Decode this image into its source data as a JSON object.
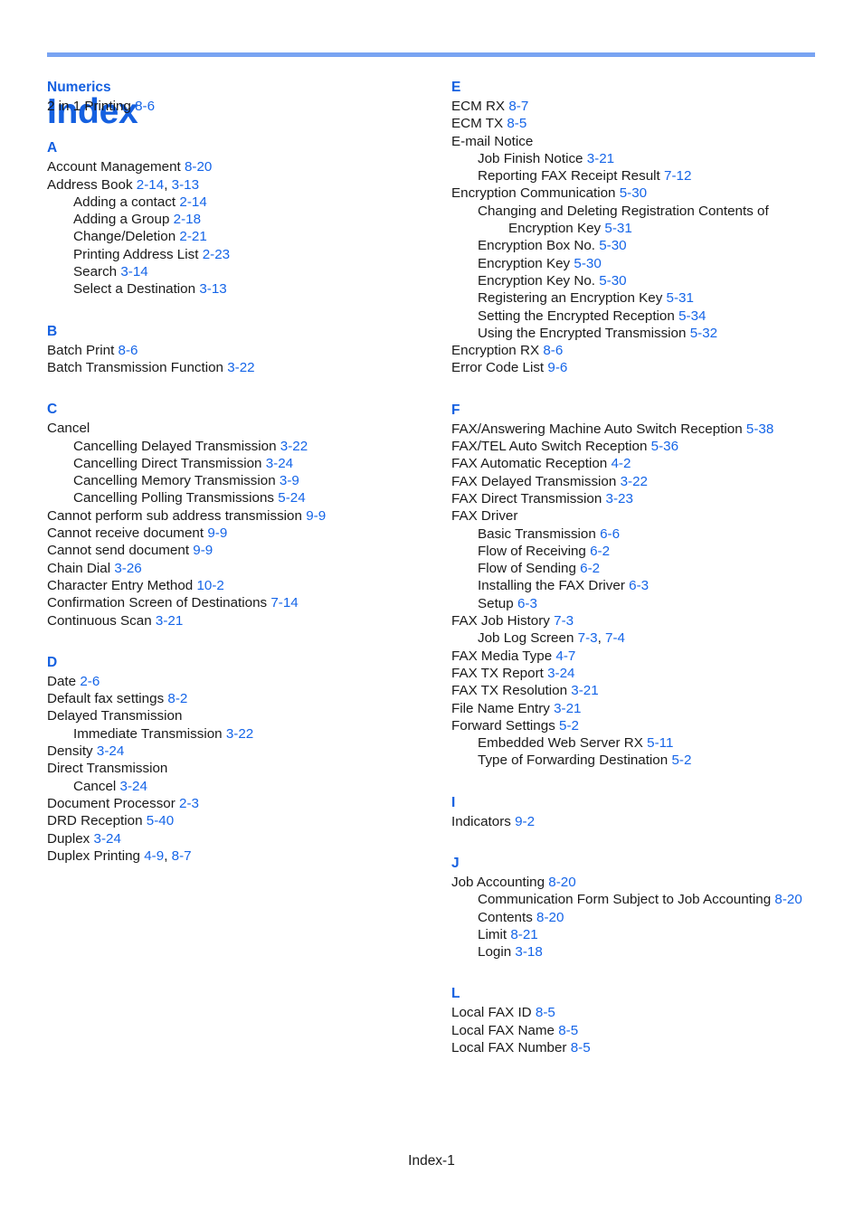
{
  "document": {
    "title": "Index",
    "footer": "Index-1"
  },
  "theme": {
    "rule_color": "#79a4f2",
    "title_color": "#1560e0",
    "section_letter_color": "#1560e0",
    "reference_color": "#1565e8",
    "text_color": "#1a1a1a",
    "background": "#ffffff"
  },
  "columns": [
    {
      "name": "left",
      "sections": [
        {
          "letter": "Numerics",
          "entries": [
            {
              "level": 0,
              "text": "2 in 1 Printing",
              "refs": [
                "8-6"
              ]
            }
          ]
        },
        {
          "letter": "A",
          "entries": [
            {
              "level": 0,
              "text": "Account Management",
              "refs": [
                "8-20"
              ]
            },
            {
              "level": 0,
              "text": "Address Book",
              "refs": [
                "2-14",
                "3-13"
              ]
            },
            {
              "level": 1,
              "text": "Adding a contact",
              "refs": [
                "2-14"
              ]
            },
            {
              "level": 1,
              "text": "Adding a Group",
              "refs": [
                "2-18"
              ]
            },
            {
              "level": 1,
              "text": "Change/Deletion",
              "refs": [
                "2-21"
              ]
            },
            {
              "level": 1,
              "text": "Printing Address List",
              "refs": [
                "2-23"
              ]
            },
            {
              "level": 1,
              "text": "Search",
              "refs": [
                "3-14"
              ]
            },
            {
              "level": 1,
              "text": "Select a Destination",
              "refs": [
                "3-13"
              ]
            }
          ]
        },
        {
          "letter": "B",
          "entries": [
            {
              "level": 0,
              "text": "Batch Print",
              "refs": [
                "8-6"
              ]
            },
            {
              "level": 0,
              "text": "Batch Transmission Function",
              "refs": [
                "3-22"
              ]
            }
          ]
        },
        {
          "letter": "C",
          "entries": [
            {
              "level": 0,
              "text": "Cancel",
              "refs": []
            },
            {
              "level": 1,
              "text": "Cancelling Delayed Transmission",
              "refs": [
                "3-22"
              ]
            },
            {
              "level": 1,
              "text": "Cancelling Direct Transmission",
              "refs": [
                "3-24"
              ]
            },
            {
              "level": 1,
              "text": "Cancelling Memory Transmission",
              "refs": [
                "3-9"
              ]
            },
            {
              "level": 1,
              "text": "Cancelling Polling Transmissions",
              "refs": [
                "5-24"
              ]
            },
            {
              "level": 0,
              "text": "Cannot perform sub address transmission",
              "refs": [
                "9-9"
              ]
            },
            {
              "level": 0,
              "text": "Cannot receive document",
              "refs": [
                "9-9"
              ]
            },
            {
              "level": 0,
              "text": "Cannot send document",
              "refs": [
                "9-9"
              ]
            },
            {
              "level": 0,
              "text": "Chain Dial",
              "refs": [
                "3-26"
              ]
            },
            {
              "level": 0,
              "text": "Character Entry Method",
              "refs": [
                "10-2"
              ]
            },
            {
              "level": 0,
              "text": "Confirmation Screen of Destinations",
              "refs": [
                "7-14"
              ]
            },
            {
              "level": 0,
              "text": "Continuous Scan",
              "refs": [
                "3-21"
              ]
            }
          ]
        },
        {
          "letter": "D",
          "entries": [
            {
              "level": 0,
              "text": "Date",
              "refs": [
                "2-6"
              ]
            },
            {
              "level": 0,
              "text": "Default fax settings",
              "refs": [
                "8-2"
              ]
            },
            {
              "level": 0,
              "text": "Delayed Transmission",
              "refs": []
            },
            {
              "level": 1,
              "text": "Immediate Transmission",
              "refs": [
                "3-22"
              ]
            },
            {
              "level": 0,
              "text": "Density",
              "refs": [
                "3-24"
              ]
            },
            {
              "level": 0,
              "text": "Direct Transmission",
              "refs": []
            },
            {
              "level": 1,
              "text": "Cancel",
              "refs": [
                "3-24"
              ]
            },
            {
              "level": 0,
              "text": "Document Processor",
              "refs": [
                "2-3"
              ]
            },
            {
              "level": 0,
              "text": "DRD Reception",
              "refs": [
                "5-40"
              ]
            },
            {
              "level": 0,
              "text": "Duplex",
              "refs": [
                "3-24"
              ]
            },
            {
              "level": 0,
              "text": "Duplex Printing",
              "refs": [
                "4-9",
                "8-7"
              ]
            }
          ]
        }
      ]
    },
    {
      "name": "right",
      "sections": [
        {
          "letter": "E",
          "entries": [
            {
              "level": 0,
              "text": "ECM RX",
              "refs": [
                "8-7"
              ]
            },
            {
              "level": 0,
              "text": "ECM TX",
              "refs": [
                "8-5"
              ]
            },
            {
              "level": 0,
              "text": "E-mail Notice",
              "refs": []
            },
            {
              "level": 1,
              "text": "Job Finish Notice",
              "refs": [
                "3-21"
              ]
            },
            {
              "level": 1,
              "text": "Reporting FAX Receipt Result",
              "refs": [
                "7-12"
              ]
            },
            {
              "level": 0,
              "text": "Encryption Communication",
              "refs": [
                "5-30"
              ]
            },
            {
              "level": 1,
              "text": "Changing and Deleting Registration Contents of Encryption Key",
              "refs": [
                "5-31"
              ]
            },
            {
              "level": 1,
              "text": "Encryption Box No.",
              "refs": [
                "5-30"
              ]
            },
            {
              "level": 1,
              "text": "Encryption Key",
              "refs": [
                "5-30"
              ]
            },
            {
              "level": 1,
              "text": "Encryption Key No.",
              "refs": [
                "5-30"
              ]
            },
            {
              "level": 1,
              "text": "Registering an Encryption Key",
              "refs": [
                "5-31"
              ]
            },
            {
              "level": 1,
              "text": "Setting the Encrypted Reception",
              "refs": [
                "5-34"
              ]
            },
            {
              "level": 1,
              "text": "Using the Encrypted Transmission",
              "refs": [
                "5-32"
              ]
            },
            {
              "level": 0,
              "text": "Encryption RX",
              "refs": [
                "8-6"
              ]
            },
            {
              "level": 0,
              "text": "Error Code List",
              "refs": [
                "9-6"
              ]
            }
          ]
        },
        {
          "letter": "F",
          "entries": [
            {
              "level": 0,
              "text": "FAX/Answering Machine Auto Switch Reception",
              "refs": [
                "5-38"
              ]
            },
            {
              "level": 0,
              "text": "FAX/TEL Auto Switch Reception",
              "refs": [
                "5-36"
              ]
            },
            {
              "level": 0,
              "text": "FAX Automatic Reception",
              "refs": [
                "4-2"
              ]
            },
            {
              "level": 0,
              "text": "FAX Delayed Transmission",
              "refs": [
                "3-22"
              ]
            },
            {
              "level": 0,
              "text": "FAX Direct Transmission",
              "refs": [
                "3-23"
              ]
            },
            {
              "level": 0,
              "text": "FAX Driver",
              "refs": []
            },
            {
              "level": 1,
              "text": "Basic Transmission",
              "refs": [
                "6-6"
              ]
            },
            {
              "level": 1,
              "text": "Flow of Receiving",
              "refs": [
                "6-2"
              ]
            },
            {
              "level": 1,
              "text": "Flow of Sending",
              "refs": [
                "6-2"
              ]
            },
            {
              "level": 1,
              "text": "Installing the FAX Driver",
              "refs": [
                "6-3"
              ]
            },
            {
              "level": 1,
              "text": "Setup",
              "refs": [
                "6-3"
              ]
            },
            {
              "level": 0,
              "text": "FAX Job History",
              "refs": [
                "7-3"
              ]
            },
            {
              "level": 1,
              "text": "Job Log Screen",
              "refs": [
                "7-3",
                "7-4"
              ]
            },
            {
              "level": 0,
              "text": "FAX Media Type",
              "refs": [
                "4-7"
              ]
            },
            {
              "level": 0,
              "text": "FAX TX Report",
              "refs": [
                "3-24"
              ]
            },
            {
              "level": 0,
              "text": "FAX TX Resolution",
              "refs": [
                "3-21"
              ]
            },
            {
              "level": 0,
              "text": "File Name Entry",
              "refs": [
                "3-21"
              ]
            },
            {
              "level": 0,
              "text": "Forward Settings",
              "refs": [
                "5-2"
              ]
            },
            {
              "level": 1,
              "text": "Embedded Web Server RX",
              "refs": [
                "5-11"
              ]
            },
            {
              "level": 1,
              "text": "Type of Forwarding Destination",
              "refs": [
                "5-2"
              ]
            }
          ]
        },
        {
          "letter": "I",
          "entries": [
            {
              "level": 0,
              "text": "Indicators",
              "refs": [
                "9-2"
              ]
            }
          ]
        },
        {
          "letter": "J",
          "entries": [
            {
              "level": 0,
              "text": "Job Accounting",
              "refs": [
                "8-20"
              ]
            },
            {
              "level": 1,
              "text": "Communication Form Subject to Job Accounting",
              "refs": [
                "8-20"
              ]
            },
            {
              "level": 1,
              "text": "Contents",
              "refs": [
                "8-20"
              ]
            },
            {
              "level": 1,
              "text": "Limit",
              "refs": [
                "8-21"
              ]
            },
            {
              "level": 1,
              "text": "Login",
              "refs": [
                "3-18"
              ]
            }
          ]
        },
        {
          "letter": "L",
          "entries": [
            {
              "level": 0,
              "text": "Local FAX ID",
              "refs": [
                "8-5"
              ]
            },
            {
              "level": 0,
              "text": "Local FAX Name",
              "refs": [
                "8-5"
              ]
            },
            {
              "level": 0,
              "text": "Local FAX Number",
              "refs": [
                "8-5"
              ]
            }
          ]
        }
      ]
    }
  ]
}
